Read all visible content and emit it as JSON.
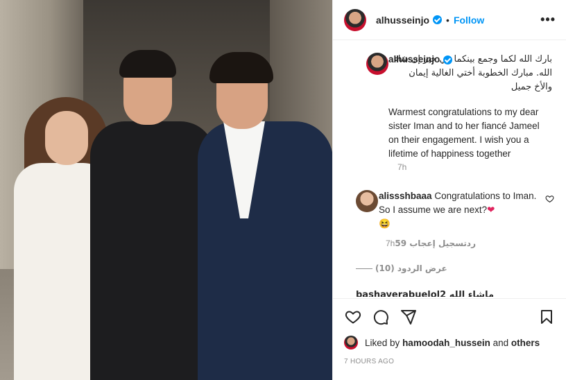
{
  "post": {
    "username": "alhusseinjo",
    "follow_label": "Follow",
    "more_label": "•••",
    "separator": "•",
    "caption_arabic": "بارك الله لكما وجمع بينكما في خير إن شاء الله. مبارك الخطوبة أختي الغالية إيمان والأخ جميل",
    "caption_english": "Warmest congratulations to my dear sister Iman and to her fiancé Jameel on their engagement. I wish you a lifetime of happiness together",
    "caption_time": "7h",
    "likes_prefix": "Liked by",
    "likes_user": "hamoodah_hussein",
    "likes_and": "and",
    "likes_others": "others",
    "timestamp": "7 HOURS AGO"
  },
  "comment": {
    "username": "alissshbaaa",
    "text": "Congratulations to Iman. So I assume we are next?",
    "emoji_heart": "❤",
    "emoji_laugh": "😆",
    "time": "7h",
    "likes": "تسجيل إعجاب 59",
    "reply": "رد",
    "view_replies": "عرض الردود (10)",
    "partial_next": "bashayerabuelol2 ماشاء الله"
  },
  "colors": {
    "accent": "#0095f6",
    "muted": "#8e8e8e",
    "text": "#262626"
  },
  "icons": {
    "like": "heart-icon",
    "comment": "comment-icon",
    "share": "share-icon",
    "save": "bookmark-icon"
  }
}
